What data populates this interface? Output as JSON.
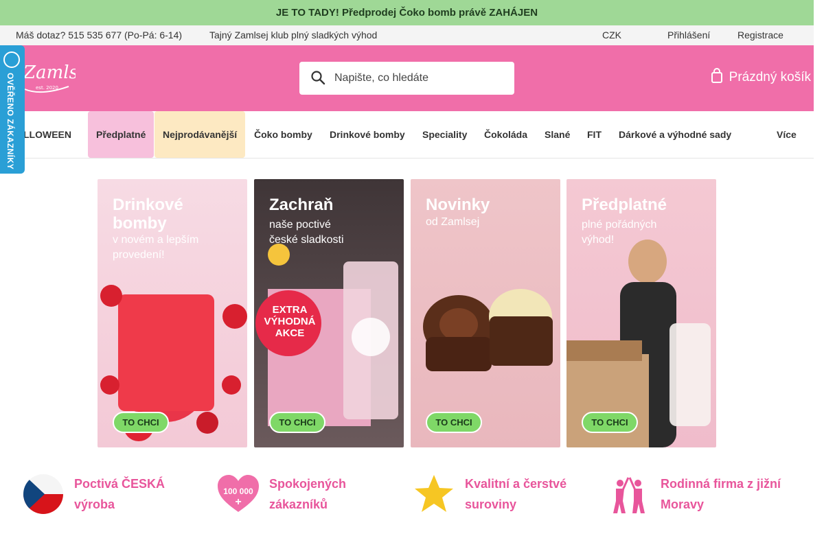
{
  "promo": {
    "text": "JE TO TADY! Předprodej Čoko bomb právě ZAHÁJEN"
  },
  "topbar": {
    "question": "Máš dotaz? 515 535 677 (Po-Pá: 6-14)",
    "club": "Tajný Zamlsej klub  plný sladkých výhod",
    "currency": "CZK",
    "currency_arrow": "",
    "login": "Přihlášení",
    "register": "Registrace"
  },
  "header": {
    "logo_text": "Zamlsej",
    "logo_est": "est. 2020",
    "search_placeholder": "Napište, co hledáte",
    "cart": "Prázdný košík"
  },
  "badge": {
    "text": "OVĚŘENO ZÁKAZNÍKY"
  },
  "nav": {
    "items": [
      "LLOWEEN ",
      "Předplatné",
      "Nejprodávanější",
      "Čoko bomby",
      "Drinkové bomby",
      "Speciality",
      "Čokoláda",
      "Slané",
      "FIT",
      "Dárkové a výhodné sady",
      "Více "
    ]
  },
  "banners": [
    {
      "title": "Drinkové\nbomby",
      "sub": "v novém a lepším\nprovedení!",
      "cta": "TO CHCI"
    },
    {
      "title": "Zachraň",
      "sub": "naše poctivé\nčeské sladkosti",
      "sticker": "EXTRA\nVÝHODNÁ\nAKCE",
      "cta": "TO CHCI"
    },
    {
      "title": "Novinky",
      "sub": "od Zamlsej",
      "cta": "TO CHCI"
    },
    {
      "title": "Předplatné",
      "sub": "plné pořádných\nvýhod!",
      "cta": "TO CHCI"
    }
  ],
  "features": [
    {
      "text": "Poctivá ČESKÁ výroba",
      "icon": "czech-flag-icon"
    },
    {
      "text": "Spokojených zákazníků",
      "icon": "heart-icon",
      "icon_text": "100 000"
    },
    {
      "text": "Kvalitní a čerstvé suroviny",
      "icon": "star-icon"
    },
    {
      "text": "Rodinná firma z jižní Moravy",
      "icon": "family-icon"
    }
  ],
  "colors": {
    "promo": "#9fd896",
    "header": "#f06ea9",
    "accent_text": "#e8559b",
    "badge": "#2a9fd6",
    "cta": "#7fd867"
  }
}
